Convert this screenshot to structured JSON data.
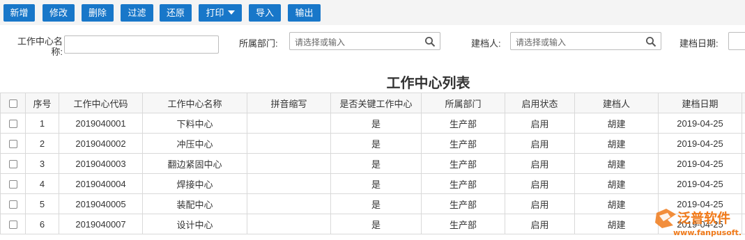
{
  "toolbar": {
    "buttons": [
      {
        "label": "新增"
      },
      {
        "label": "修改"
      },
      {
        "label": "删除"
      },
      {
        "label": "过滤"
      },
      {
        "label": "还原"
      },
      {
        "label": "打印"
      },
      {
        "label": "导入"
      },
      {
        "label": "输出"
      }
    ]
  },
  "filters": {
    "work_center_name_label": "工作中心名称:",
    "work_center_name_value": "",
    "department_label": "所属部门:",
    "department_placeholder": "请选择或输入",
    "creator_label": "建档人:",
    "creator_placeholder": "请选择或输入",
    "date_label": "建档日期:"
  },
  "title": "工作中心列表",
  "table": {
    "columns": [
      "序号",
      "工作中心代码",
      "工作中心名称",
      "拼音缩写",
      "是否关键工作中心",
      "所属部门",
      "启用状态",
      "建档人",
      "建档日期"
    ],
    "rows": [
      {
        "index": "1",
        "code": "2019040001",
        "name": "下料中心",
        "pinyin": "",
        "key": "是",
        "dept": "生产部",
        "status": "启用",
        "creator": "胡建",
        "date": "2019-04-25"
      },
      {
        "index": "2",
        "code": "2019040002",
        "name": "冲压中心",
        "pinyin": "",
        "key": "是",
        "dept": "生产部",
        "status": "启用",
        "creator": "胡建",
        "date": "2019-04-25"
      },
      {
        "index": "3",
        "code": "2019040003",
        "name": "翻边紧固中心",
        "pinyin": "",
        "key": "是",
        "dept": "生产部",
        "status": "启用",
        "creator": "胡建",
        "date": "2019-04-25"
      },
      {
        "index": "4",
        "code": "2019040004",
        "name": "焊接中心",
        "pinyin": "",
        "key": "是",
        "dept": "生产部",
        "status": "启用",
        "creator": "胡建",
        "date": "2019-04-25"
      },
      {
        "index": "5",
        "code": "2019040005",
        "name": "装配中心",
        "pinyin": "",
        "key": "是",
        "dept": "生产部",
        "status": "启用",
        "creator": "胡建",
        "date": "2019-04-25"
      },
      {
        "index": "6",
        "code": "2019040007",
        "name": "设计中心",
        "pinyin": "",
        "key": "是",
        "dept": "生产部",
        "status": "启用",
        "creator": "胡建",
        "date": "2019-04-25"
      }
    ]
  },
  "watermark": {
    "brand": "泛普软件",
    "url": "www.fanpusoft.com"
  },
  "colors": {
    "button_blue": "#1877c9",
    "link_blue": "#1e3fa8",
    "watermark_orange": "#f07a1a"
  }
}
